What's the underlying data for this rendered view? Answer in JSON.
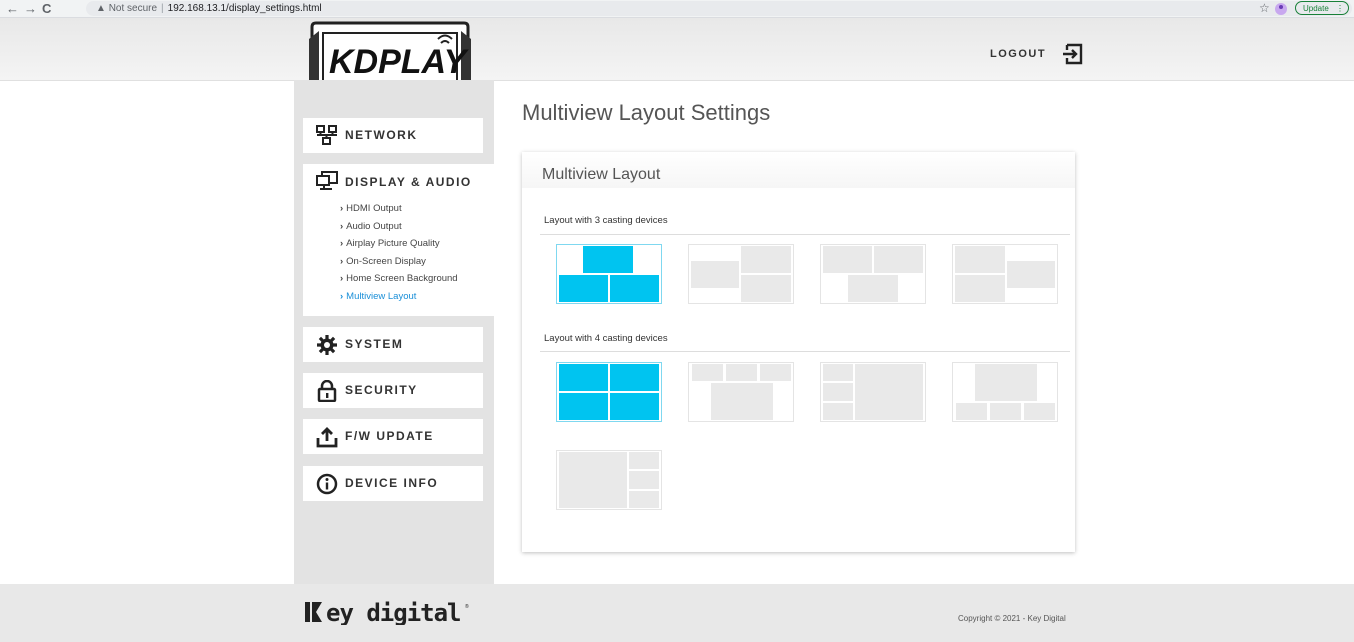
{
  "browser": {
    "url_warning": "Not secure",
    "url": "192.168.13.1/display_settings.html",
    "update_label": "Update"
  },
  "header": {
    "logout_label": "LOGOUT"
  },
  "sidebar": {
    "items": [
      {
        "label": "NETWORK",
        "icon": "network-icon"
      },
      {
        "label": "DISPLAY & AUDIO",
        "icon": "display-icon",
        "expanded": true,
        "subitems": [
          "HDMI Output",
          "Audio Output",
          "Airplay Picture Quality",
          "On-Screen Display",
          "Home Screen Background",
          "Multiview Layout"
        ],
        "active_subitem": "Multiview Layout"
      },
      {
        "label": "SYSTEM",
        "icon": "gear-icon"
      },
      {
        "label": "SECURITY",
        "icon": "lock-icon"
      },
      {
        "label": "F/W UPDATE",
        "icon": "upload-icon"
      },
      {
        "label": "DEVICE INFO",
        "icon": "info-icon"
      }
    ]
  },
  "main": {
    "page_title": "Multiview Layout Settings",
    "card_title": "Multiview Layout",
    "groups": [
      {
        "label": "Layout with 3 casting devices",
        "layouts": 4,
        "selected_index": 0
      },
      {
        "label": "Layout with 4 casting devices",
        "layouts": 5,
        "selected_index": 0
      }
    ]
  },
  "footer": {
    "copyright": "Copyright © 2021 - Key Digital"
  },
  "colors": {
    "selected": "#00c4f0",
    "unselected": "#e9e9e9",
    "active_link": "#1a8fd8"
  }
}
